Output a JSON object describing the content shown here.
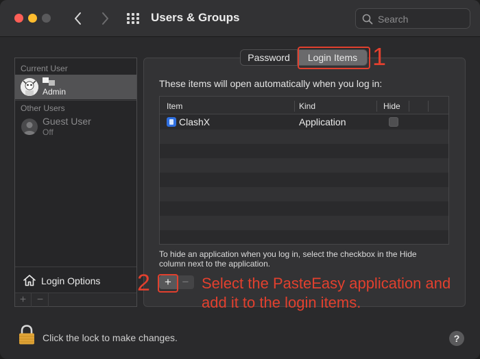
{
  "window": {
    "title": "Users & Groups",
    "search_placeholder": "Search"
  },
  "sidebar": {
    "current_user_header": "Current User",
    "current_user_role": "Admin",
    "other_users_header": "Other Users",
    "guest_name": "Guest User",
    "guest_status": "Off",
    "login_options_label": "Login Options",
    "add_label": "+",
    "remove_label": "−"
  },
  "tabs": {
    "password": "Password",
    "login_items": "Login Items",
    "selected": "Login Items"
  },
  "login_items": {
    "intro": "These items will open automatically when you log in:",
    "columns": [
      "Item",
      "Kind",
      "Hide"
    ],
    "rows": [
      {
        "item": "ClashX",
        "kind": "Application",
        "hide": false
      }
    ],
    "hint": "To hide an application when you log in, select the checkbox in the Hide column next to the application.",
    "add_label": "+",
    "remove_label": "−"
  },
  "annotations": {
    "step1": "1",
    "step2": "2",
    "instruction": "Select the PasteEasy application and add it to the login items.",
    "color": "#e2402e"
  },
  "footer": {
    "lock_text": "Click the lock to make changes.",
    "help_label": "?"
  }
}
